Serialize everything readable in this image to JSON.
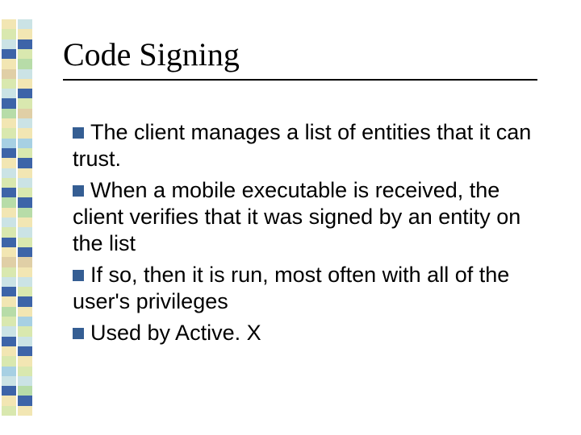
{
  "title": "Code Signing",
  "bullets": [
    "The client manages a list of entities that it can trust.",
    "When a mobile executable is received, the client verifies that it was signed by an entity on the list",
    "If so, then it is run, most often with all of the user's privileges",
    "Used by Active. X"
  ],
  "colors": {
    "bullet": "#355e93",
    "palette": [
      "#f2e6b3",
      "#d9e8af",
      "#cbe3e5",
      "#3d64a8",
      "#e0cfa6",
      "#b7dca8",
      "#a7d0e3",
      "#2f4d8a",
      "#efe7c4"
    ]
  },
  "sidebar": {
    "left": [
      0,
      1,
      2,
      3,
      0,
      4,
      1,
      2,
      3,
      5,
      0,
      1,
      6,
      3,
      0,
      2,
      1,
      3,
      5,
      0,
      2,
      1,
      3,
      0,
      4,
      1,
      2,
      3,
      0,
      5,
      1,
      2,
      3,
      0,
      1,
      6,
      2,
      3,
      0,
      1
    ],
    "right": [
      2,
      0,
      3,
      1,
      5,
      2,
      0,
      3,
      1,
      4,
      2,
      0,
      6,
      1,
      3,
      0,
      2,
      1,
      3,
      5,
      0,
      2,
      1,
      3,
      4,
      0,
      2,
      1,
      3,
      0,
      6,
      1,
      2,
      3,
      0,
      1,
      2,
      5,
      3,
      0
    ]
  }
}
